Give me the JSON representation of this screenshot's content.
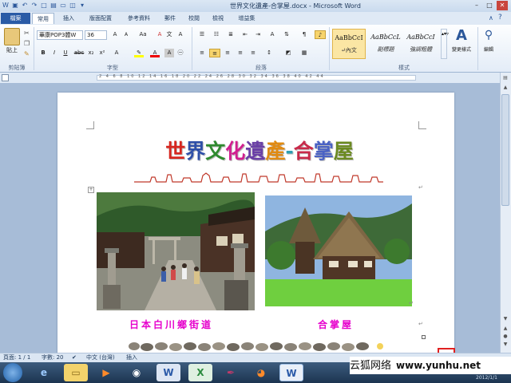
{
  "titlebar": {
    "title": "世界文化遺產-合掌屋.docx - Microsoft Word",
    "min": "–",
    "max": "□",
    "close": "✕"
  },
  "tabs": {
    "file": "檔案",
    "items": [
      "常用",
      "插入",
      "版面配置",
      "參考資料",
      "郵件",
      "校閱",
      "檢視",
      "增益集"
    ]
  },
  "ribbon": {
    "clipboard": {
      "paste": "貼上",
      "label": "剪貼簿"
    },
    "font": {
      "name": "華康POP3體W",
      "size": "36",
      "label": "字型"
    },
    "paragraph": {
      "label": "段落"
    },
    "styles": {
      "items": [
        {
          "sample": "AaBbCcI",
          "name": "↵內文"
        },
        {
          "sample": "AaBbCcL",
          "name": "副標題"
        },
        {
          "sample": "AaBbCcI",
          "name": "強調粗體"
        }
      ],
      "change": "變更樣式",
      "label": "樣式"
    },
    "editing": {
      "label": "編輯"
    }
  },
  "ruler": {
    "ticks": "2 4 6 8 10 12 14 16 18 20 22 24 26 28 30 32 34 36 38 40 42 44"
  },
  "document": {
    "title_chars": [
      {
        "ch": "世",
        "color": "#d7261f"
      },
      {
        "ch": "界",
        "color": "#2e4fa8"
      },
      {
        "ch": "文",
        "color": "#2e8a2e"
      },
      {
        "ch": "化",
        "color": "#d11f8f"
      },
      {
        "ch": "遺",
        "color": "#6a3fa6"
      },
      {
        "ch": "產",
        "color": "#e08a12"
      },
      {
        "ch": "-",
        "color": "#2e9fb3"
      },
      {
        "ch": "合",
        "color": "#c82a4a"
      },
      {
        "ch": "掌",
        "color": "#4a62c4"
      },
      {
        "ch": "屋",
        "color": "#6b8a21"
      }
    ],
    "caption_left": "日本白川鄉街道",
    "caption_right": "合掌屋"
  },
  "status": {
    "page": "頁面: 1 / 1",
    "words": "字數: 20",
    "lang": "中文 (台灣)",
    "mode": "插入"
  },
  "watermark": {
    "cn": "云狐网络",
    "url": "www.yunhu.net"
  },
  "tray": {
    "date": "2012/1/1"
  },
  "colors": {
    "accent": "#2a5ba6",
    "caption": "#e600cc"
  }
}
